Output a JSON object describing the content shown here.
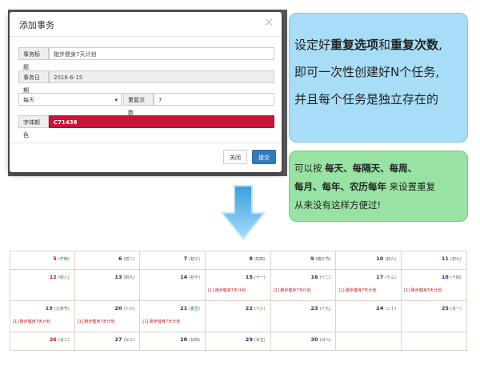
{
  "modal": {
    "title": "添加事务",
    "close_symbol": "×",
    "fields": {
      "title_label": "事务标题",
      "title_value": "跑步健身7天计划",
      "date_label": "事务日期",
      "date_value": "2016-6-15",
      "repeat_option": "每天",
      "repeat_count_label": "重复次数",
      "repeat_count_value": "7",
      "color_label": "字体颜色",
      "color_value": "C71438"
    },
    "buttons": {
      "close": "关闭",
      "submit": "提交"
    }
  },
  "callout_blue": {
    "line1": [
      "设定好",
      "重复选项",
      "和",
      "重复次数",
      ","
    ],
    "line2": "即可一次性创建好N个任务,",
    "line3": "并且每个任务是独立存在的"
  },
  "callout_green": {
    "line1_prefix": "可以按 ",
    "line1_bold": "每天、每隔天、每周、",
    "line2_bold": "每月、每年、农历每年",
    "line2_suffix": " 来设置重复",
    "line3": "从来没有这样方便过!"
  },
  "colors": {
    "event_color": "#c71438",
    "accent": "#337ab7",
    "callout_blue": "#a8ddf7",
    "callout_green": "#98e3a3"
  },
  "calendar": {
    "event_text": "[1] 跑步健身7天计划",
    "rows": [
      [
        {
          "day": "5",
          "sub": "(芒种)",
          "day_color": "red",
          "sub_color": "green",
          "event": false
        },
        {
          "day": "6",
          "sub": "(初二)",
          "day_color": "",
          "sub_color": "",
          "event": false
        },
        {
          "day": "7",
          "sub": "(初三)",
          "day_color": "",
          "sub_color": "",
          "event": false
        },
        {
          "day": "8",
          "sub": "(初四)",
          "day_color": "",
          "sub_color": "",
          "event": false
        },
        {
          "day": "9",
          "sub": "(端午节)",
          "day_color": "",
          "sub_color": "",
          "event": false
        },
        {
          "day": "10",
          "sub": "(初六)",
          "day_color": "",
          "sub_color": "",
          "event": false
        },
        {
          "day": "11",
          "sub": "(初七)",
          "day_color": "blue",
          "sub_color": "",
          "event": false
        }
      ],
      [
        {
          "day": "12",
          "sub": "(初八)",
          "day_color": "red",
          "sub_color": "",
          "event": false
        },
        {
          "day": "13",
          "sub": "(初九)",
          "day_color": "",
          "sub_color": "",
          "event": false
        },
        {
          "day": "14",
          "sub": "(初十)",
          "day_color": "",
          "sub_color": "",
          "event": false
        },
        {
          "day": "15",
          "sub": "(十一)",
          "day_color": "",
          "sub_color": "",
          "event": true
        },
        {
          "day": "16",
          "sub": "(十二)",
          "day_color": "",
          "sub_color": "",
          "event": true
        },
        {
          "day": "17",
          "sub": "(十三)",
          "day_color": "",
          "sub_color": "",
          "event": true
        },
        {
          "day": "18",
          "sub": "(十四)",
          "day_color": "blue",
          "sub_color": "",
          "event": true
        }
      ],
      [
        {
          "day": "19",
          "sub": "(父亲节)",
          "day_color": "red",
          "sub_color": "",
          "event": true
        },
        {
          "day": "20",
          "sub": "(十六)",
          "day_color": "",
          "sub_color": "",
          "event": true
        },
        {
          "day": "21",
          "sub": "(夏至)",
          "day_color": "",
          "sub_color": "green",
          "event": true
        },
        {
          "day": "22",
          "sub": "(十八)",
          "day_color": "",
          "sub_color": "",
          "event": false
        },
        {
          "day": "23",
          "sub": "(十九)",
          "day_color": "",
          "sub_color": "",
          "event": false
        },
        {
          "day": "24",
          "sub": "(二十)",
          "day_color": "",
          "sub_color": "",
          "event": false
        },
        {
          "day": "25",
          "sub": "(廿一)",
          "day_color": "blue",
          "sub_color": "",
          "event": false
        }
      ],
      [
        {
          "day": "26",
          "sub": "(廿二)",
          "day_color": "red",
          "sub_color": "",
          "event": false
        },
        {
          "day": "27",
          "sub": "(廿三)",
          "day_color": "",
          "sub_color": "",
          "event": false
        },
        {
          "day": "28",
          "sub": "(廿四)",
          "day_color": "",
          "sub_color": "",
          "event": false
        },
        {
          "day": "29",
          "sub": "(廿五)",
          "day_color": "",
          "sub_color": "",
          "event": false
        },
        {
          "day": "30",
          "sub": "(廿六)",
          "day_color": "",
          "sub_color": "",
          "event": false
        },
        {
          "day": "",
          "sub": "",
          "day_color": "",
          "sub_color": "",
          "event": false
        },
        {
          "day": "",
          "sub": "",
          "day_color": "",
          "sub_color": "",
          "event": false
        }
      ]
    ]
  }
}
